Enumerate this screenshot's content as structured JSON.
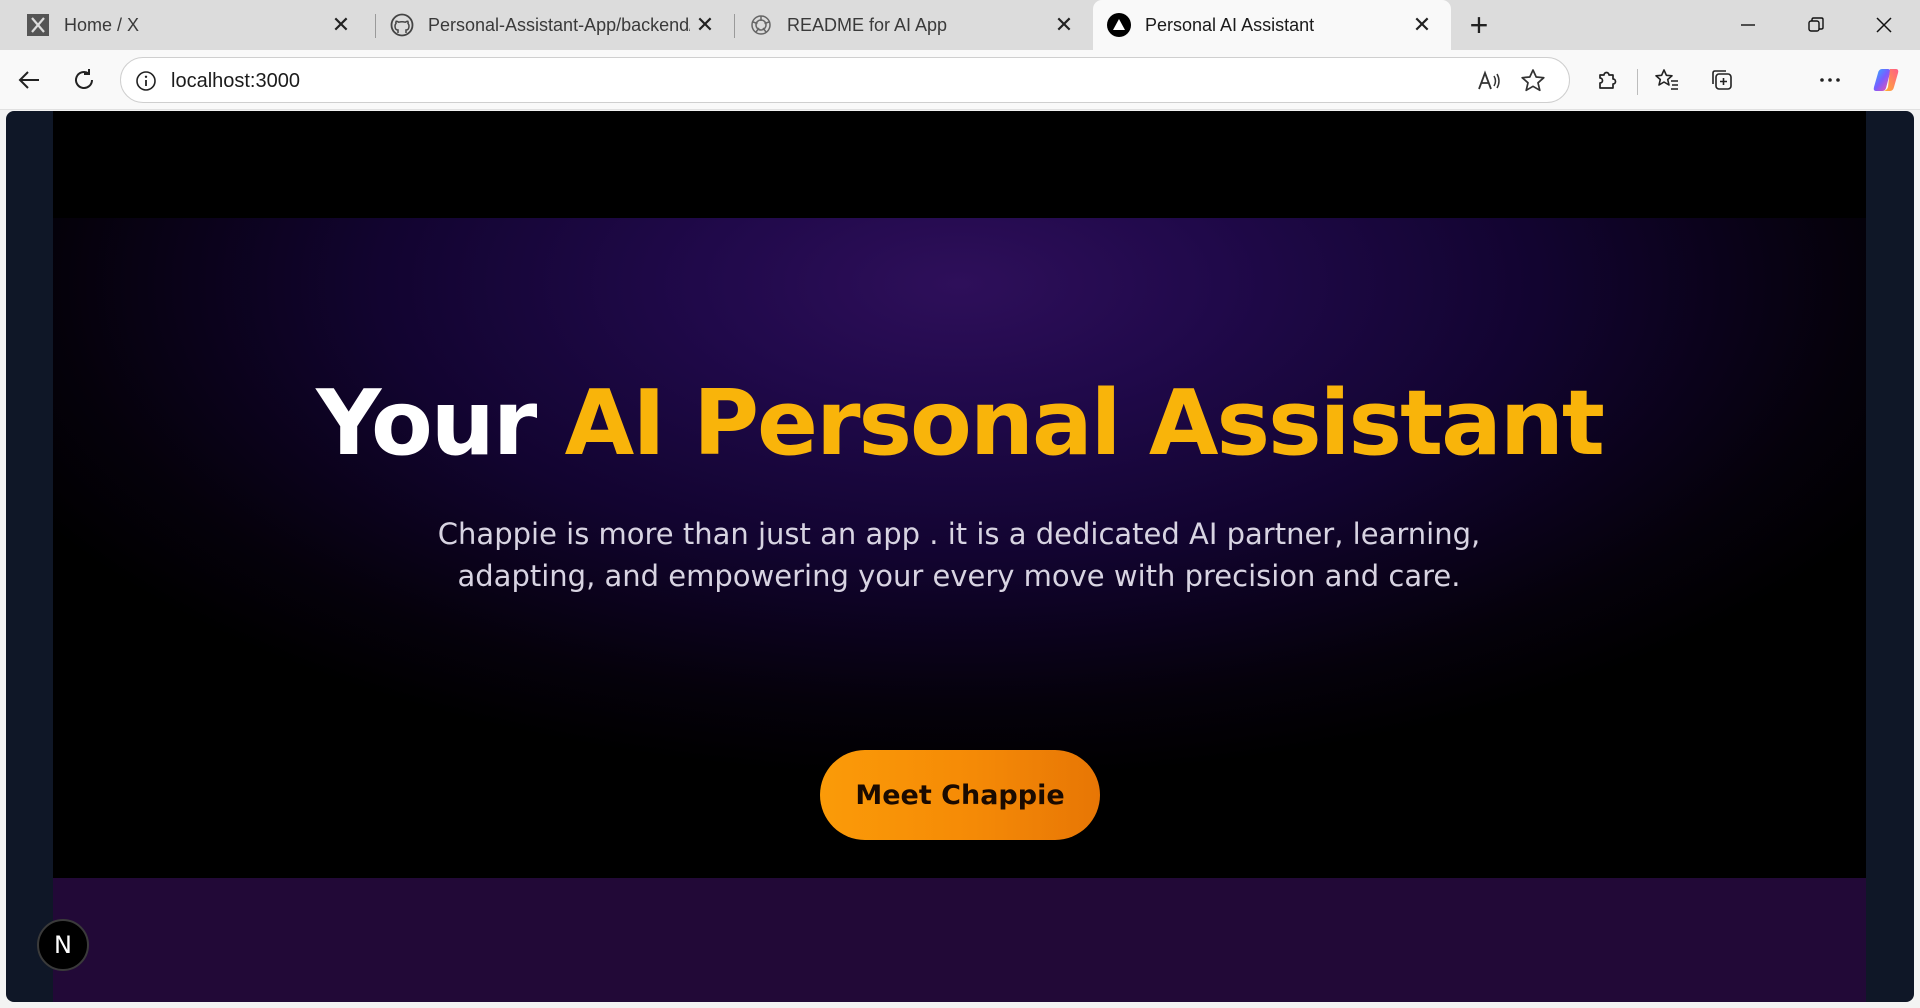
{
  "tabs": [
    {
      "title": "Home / X",
      "icon": "x-logo-icon",
      "active": false
    },
    {
      "title": "Personal-Assistant-App/backend/",
      "icon": "github-icon",
      "active": false
    },
    {
      "title": "README for AI App",
      "icon": "openai-icon",
      "active": false
    },
    {
      "title": "Personal AI Assistant",
      "icon": "vercel-triangle-icon",
      "active": true
    }
  ],
  "address_bar": {
    "url": "localhost:3000"
  },
  "hero": {
    "title_plain": "Your",
    "title_accent": "AI Personal Assistant",
    "subtitle_line1": "Chappie is more than just an app . it is a dedicated AI partner, learning,",
    "subtitle_line2": "adapting, and empowering your every move with precision and care.",
    "cta_label": "Meet Chappie"
  },
  "nextjs_badge": {
    "label": "N"
  },
  "colors": {
    "accent": "#f9b40a",
    "cta_start": "#fb9b08",
    "cta_end": "#e77605",
    "hero_glow": "#2e0f5a",
    "section2_bg": "#220937"
  }
}
